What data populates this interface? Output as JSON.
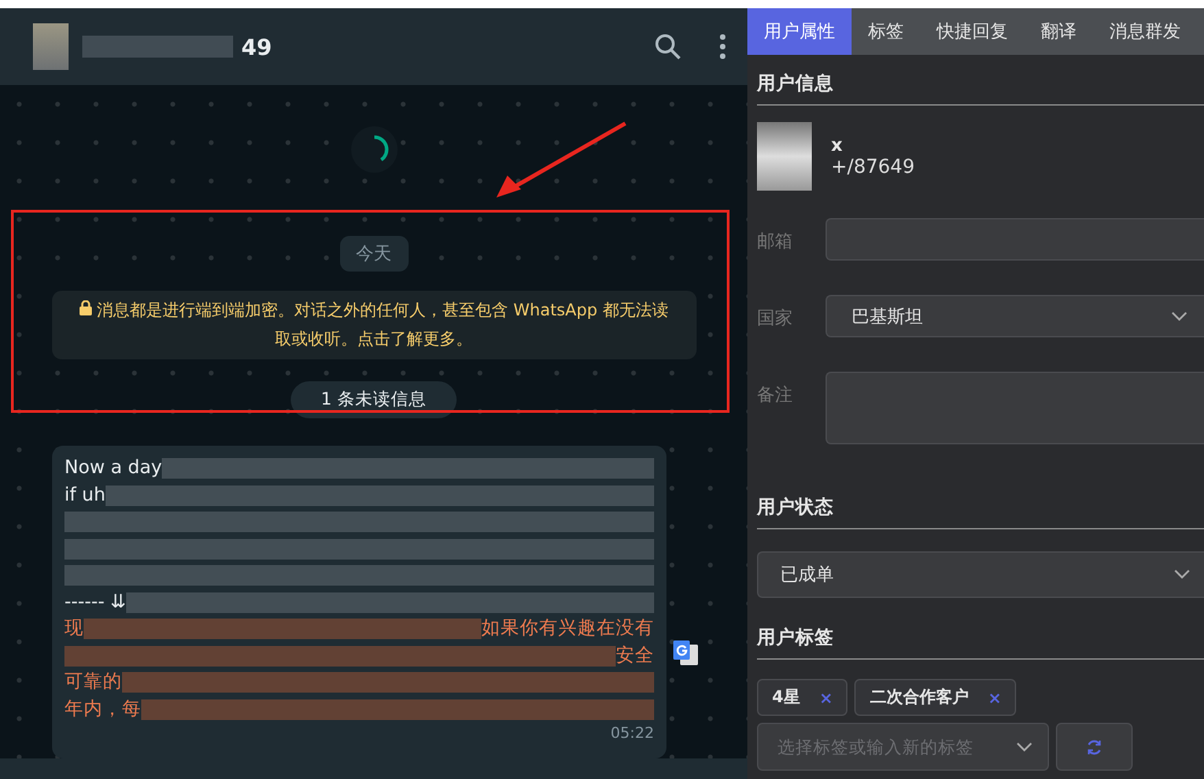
{
  "chat": {
    "header": {
      "name": "49"
    },
    "date_chip": "今天",
    "encryption_notice": "消息都是进行端到端加密。对话之外的任何人，甚至包含 WhatsApp 都无法读取或收听。点击了解更多。",
    "unread_chip": "1 条未读信息",
    "message": {
      "lines": [
        {
          "kind": "original",
          "left": "Now a day"
        },
        {
          "kind": "original",
          "left": "if uh"
        },
        {
          "kind": "redacted"
        },
        {
          "kind": "redacted"
        },
        {
          "kind": "redacted"
        },
        {
          "kind": "original",
          "left": "------ ⇊"
        },
        {
          "kind": "translation",
          "left": "现",
          "right": "如果你有兴趣在没有"
        },
        {
          "kind": "translation",
          "right": "安全"
        },
        {
          "kind": "translation",
          "left": "可靠的"
        },
        {
          "kind": "translation",
          "left": "年内，每"
        }
      ],
      "time": "05:22"
    }
  },
  "panel": {
    "tabs": [
      {
        "label": "用户属性",
        "selected": true
      },
      {
        "label": "标签",
        "selected": false
      },
      {
        "label": "快捷回复",
        "selected": false
      },
      {
        "label": "翻译",
        "selected": false
      },
      {
        "label": "消息群发",
        "selected": false
      }
    ],
    "user_info": {
      "title": "用户信息",
      "name": "x",
      "phone": "+/87649",
      "fields": [
        {
          "kind": "input",
          "label": "邮箱"
        },
        {
          "kind": "select",
          "label": "国家",
          "value": "巴基斯坦"
        },
        {
          "kind": "textarea",
          "label": "备注"
        }
      ]
    },
    "user_status": {
      "title": "用户状态",
      "value": "已成单"
    },
    "user_tags": {
      "title": "用户标签",
      "tags": [
        {
          "label": "4星",
          "remove": "×"
        },
        {
          "label": "二次合作客户",
          "remove": "×"
        }
      ],
      "placeholder": "选择标签或输入新的标签"
    }
  }
}
